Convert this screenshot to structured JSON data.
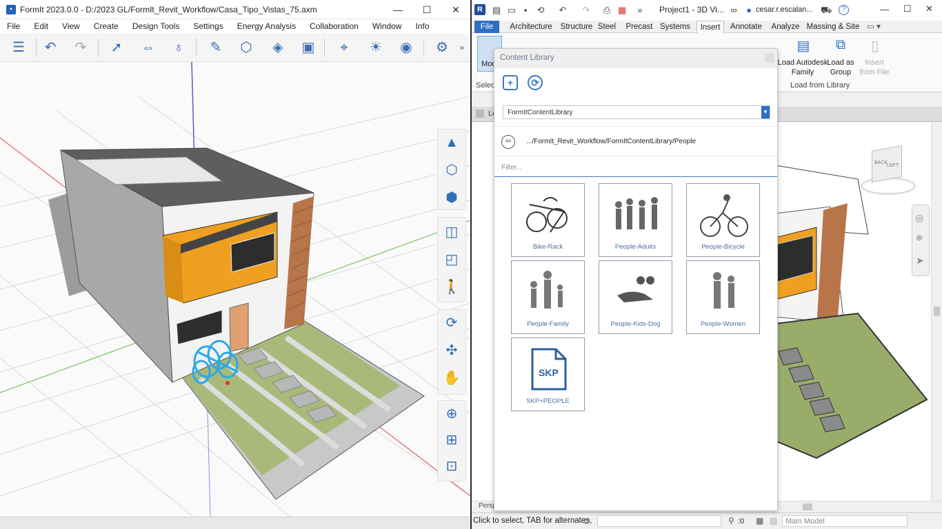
{
  "formit": {
    "title": "FormIt 2023.0.0 - D:/2023 GL/FormIt_Revit_Workflow/Casa_Tipo_Vistas_75.axm",
    "menu": [
      "File",
      "Edit",
      "View",
      "Create",
      "Design Tools",
      "Settings",
      "Energy Analysis",
      "Collaboration",
      "Window",
      "Info"
    ],
    "window_controls": {
      "minimize": "—",
      "maximize": "☐",
      "close": "✕"
    },
    "toolbar_overflow": "»"
  },
  "revit": {
    "logo": "R",
    "title": "Project1 - 3D Vi...",
    "user": "cesar.r.escalan...",
    "help": "?",
    "tabs": [
      "File",
      "Architecture",
      "Structure",
      "Steel",
      "Precast",
      "Systems",
      "Insert",
      "Annotate",
      "Analyze",
      "Massing & Site"
    ],
    "active_tab": "Insert",
    "ribbon": {
      "modify_label": "Modi",
      "select_label": "Select",
      "load_autodesk_family": "Load Autodesk Family",
      "load_as_group": "Load as Group",
      "insert_from_file": "Insert from File",
      "load_from_library_panel": "Load from Library"
    },
    "view_tab_partial": "Le",
    "perspective_label": "Persp",
    "status_text": "Click to select, TAB for alternates,",
    "status_zero": ":0",
    "model_select": "Main Model",
    "viewcube": {
      "face_left": "LEFT",
      "face_back": "BACK"
    }
  },
  "content_library": {
    "title": "Content Library",
    "source": "FormItContentLibrary",
    "path": ".../FormIt_Revit_Workflow/FormItContentLibrary/People",
    "filter_placeholder": "Filter...",
    "items": [
      {
        "label": "Bike-Rack",
        "icon": "bike-rack-icon"
      },
      {
        "label": "People-Adults",
        "icon": "people-adults-icon"
      },
      {
        "label": "People-Bicycle",
        "icon": "people-bicycle-icon"
      },
      {
        "label": "People-Family",
        "icon": "people-family-icon"
      },
      {
        "label": "People-Kids-Dog",
        "icon": "people-kids-dog-icon"
      },
      {
        "label": "People-Women",
        "icon": "people-women-icon"
      },
      {
        "label": "SKP+PEOPLE",
        "icon": "skp-file-icon",
        "badge": "SKP"
      }
    ]
  },
  "colors": {
    "formit_accent": "#2f6fb6",
    "revit_file_tab": "#2e6fc1",
    "house_orange": "#f0a020",
    "lawn_green": "#9cae6a",
    "selection_blue": "#2aa8e8"
  }
}
